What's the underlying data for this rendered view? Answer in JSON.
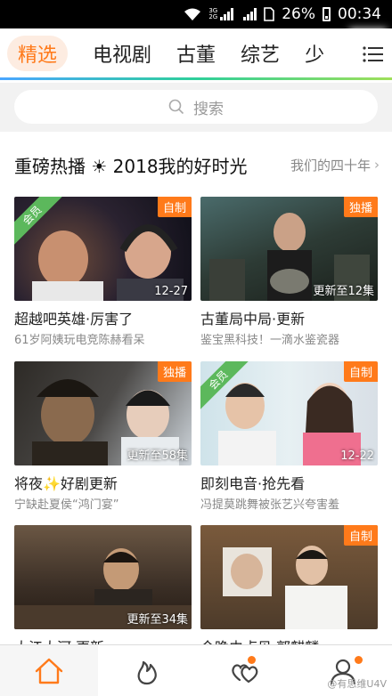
{
  "status_bar": {
    "net_top": "3G",
    "net_bottom": "2G",
    "battery": "26%",
    "time": "00:34"
  },
  "tabs": [
    {
      "label": "精选",
      "active": true
    },
    {
      "label": "电视剧",
      "active": false
    },
    {
      "label": "古董",
      "active": false
    },
    {
      "label": "综艺",
      "active": false
    },
    {
      "label": "少",
      "active": false
    }
  ],
  "search": {
    "placeholder": "搜索"
  },
  "section": {
    "title_prefix": "重磅热播",
    "title_icon": "☀",
    "title_suffix": "2018我的好时光",
    "more_label": "我们的四十年",
    "more_chevron": "›"
  },
  "cards": [
    {
      "title": "超越吧英雄·厉害了",
      "subtitle": "61岁阿姨玩电竞陈赫看呆",
      "tag": "自制",
      "vip": "会员",
      "episode": "12-27"
    },
    {
      "title": "古董局中局·更新",
      "subtitle": "鉴宝黑科技！一滴水鉴瓷器",
      "tag": "独播",
      "vip": "",
      "episode": "更新至12集"
    },
    {
      "title": "将夜✨好剧更新",
      "subtitle": "宁缺赴夏侯“鸿门宴”",
      "tag": "独播",
      "vip": "",
      "episode": "更新至58集"
    },
    {
      "title": "即刻电音·抢先看",
      "subtitle": "冯提莫跳舞被张艺兴夸害羞",
      "tag": "自制",
      "vip": "会员",
      "episode": "12-22"
    },
    {
      "title": "大江大河·更新",
      "subtitle": "",
      "tag": "",
      "vip": "",
      "episode": "更新至34集"
    },
    {
      "title": "今晚由卢贝·郭麒麟",
      "subtitle": "",
      "tag": "自制",
      "vip": "",
      "episode": ""
    }
  ],
  "bottom_nav": [
    {
      "name": "home",
      "icon": "home-icon",
      "active": true,
      "badge": false
    },
    {
      "name": "hot",
      "icon": "flame-icon",
      "active": false,
      "badge": false
    },
    {
      "name": "follow",
      "icon": "hearts-icon",
      "active": false,
      "badge": true
    },
    {
      "name": "me",
      "icon": "user-icon",
      "active": false,
      "badge": true
    }
  ],
  "watermark": "@有思维U4V",
  "colors": {
    "accent": "#ff7a1a",
    "vip_green": "#5cb85c",
    "search_bg": "#f2f2f2"
  }
}
